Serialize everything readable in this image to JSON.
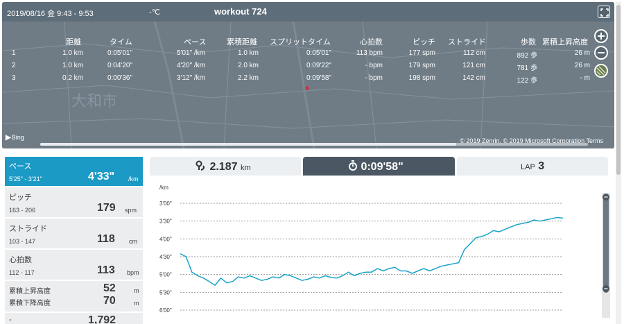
{
  "header": {
    "datetime": "2019/08/16 金 9:43 - 9:53",
    "temperature": "-℃",
    "title": "workout 724"
  },
  "laps": {
    "columns": [
      "",
      "距離",
      "タイム",
      "ペース",
      "累積距離",
      "スプリットタイム",
      "心拍数",
      "ピッチ",
      "ストライド",
      "歩数",
      "累積上昇高度"
    ],
    "rows": [
      [
        "1",
        "1.0 km",
        "0:05'01\"",
        "5'01\" /km",
        "1.0 km",
        "0:05'01\"",
        "113 bpm",
        "177 spm",
        "112 cm",
        "892 歩",
        "26 m"
      ],
      [
        "2",
        "1.0 km",
        "0:04'20\"",
        "4'20\" /km",
        "2.0 km",
        "0:09'22\"",
        "- bpm",
        "179 spm",
        "121 cm",
        "781 歩",
        "26 m"
      ],
      [
        "3",
        "0.2 km",
        "0:00'36\"",
        "3'12\" /km",
        "2.2 km",
        "0:09'58\"",
        "- bpm",
        "198 spm",
        "142 cm",
        "122 歩",
        "- m"
      ]
    ]
  },
  "map": {
    "place_label": "大和市",
    "attribution_brand": "Bing",
    "copyright": "© 2019 Zenrin, © 2019 Microsoft Corporation  Terms"
  },
  "metrics": [
    {
      "label": "ペース",
      "range": "5'25\" - 3'21\"",
      "value": "4'33\"",
      "unit": "/km",
      "selected": true
    },
    {
      "label": "ピッチ",
      "range": "163 - 206",
      "value": "179",
      "unit": "spm"
    },
    {
      "label": "ストライド",
      "range": "103 - 147",
      "value": "118",
      "unit": "cm"
    },
    {
      "label": "心拍数",
      "range": "112 - 117",
      "value": "113",
      "unit": "bpm"
    },
    {
      "label_up": "累積上昇高度",
      "label_down": "累積下降高度",
      "value_up": "52",
      "value_down": "70",
      "unit": "m"
    },
    {
      "label": "-",
      "value": "1,792"
    }
  ],
  "tabs": {
    "distance_value": "2.187",
    "distance_unit": "km",
    "time_value": "0:09'58\"",
    "lap_label": "LAP",
    "lap_value": "3"
  },
  "colors": {
    "accent": "#1c9ac6",
    "series": "#1aa3c9",
    "tab_active": "#4b5863"
  },
  "chart_data": {
    "type": "line",
    "ylabel": "/km",
    "y_axis": "reversed",
    "y_tick_labels": [
      "3'00\"",
      "3'30\"",
      "4'00\"",
      "4'30\"",
      "5'00\"",
      "5'30\"",
      "6'00\""
    ],
    "ylim_sec": [
      180,
      360
    ],
    "series": [
      {
        "values_sec": [
          265,
          270,
          296,
          302,
          306,
          312,
          318,
          306,
          314,
          312,
          304,
          306,
          302,
          306,
          310,
          308,
          304,
          306,
          300,
          302,
          306,
          310,
          308,
          304,
          306,
          302,
          305,
          306,
          302,
          296,
          302,
          298,
          296,
          296,
          290,
          294,
          290,
          288,
          294,
          294,
          298,
          294,
          290,
          294,
          290,
          286,
          284,
          282,
          280,
          258,
          248,
          238,
          236,
          232,
          226,
          228,
          224,
          220,
          216,
          214,
          212,
          208,
          210,
          208,
          206,
          204,
          205
        ]
      }
    ]
  }
}
